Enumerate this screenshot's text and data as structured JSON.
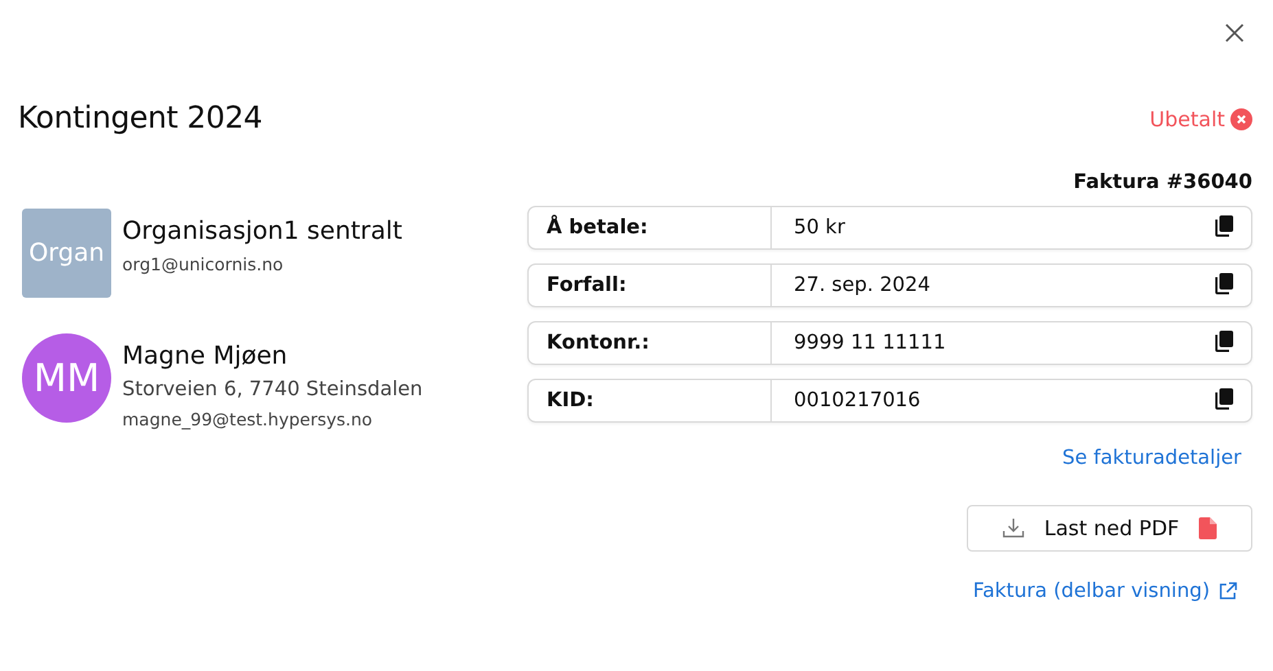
{
  "title": "Kontingent 2024",
  "status": {
    "label": "Ubetalt",
    "paid": false
  },
  "invoice_number": "Faktura #36040",
  "contacts": [
    {
      "kind": "organization",
      "avatar": "Organ",
      "color": "#9eb3c9",
      "name": "Organisasjon1 sentralt",
      "lines": [
        "org1@unicornis.no"
      ]
    },
    {
      "kind": "person",
      "avatar": "MM",
      "color": "#b65de6",
      "name": "Magne Mjøen",
      "lines": [
        "Storveien 6, 7740 Steinsdalen",
        "magne_99@test.hypersys.no"
      ]
    }
  ],
  "fields": [
    {
      "label": "Å betale:",
      "value": "50 kr"
    },
    {
      "label": "Forfall:",
      "value": "27. sep. 2024"
    },
    {
      "label": "Kontonr.:",
      "value": "9999 11 11111"
    },
    {
      "label": "KID:",
      "value": "0010217016"
    }
  ],
  "details_link": "Se fakturadetaljer",
  "download_button": "Last ned PDF",
  "share_link": "Faktura (delbar visning)"
}
